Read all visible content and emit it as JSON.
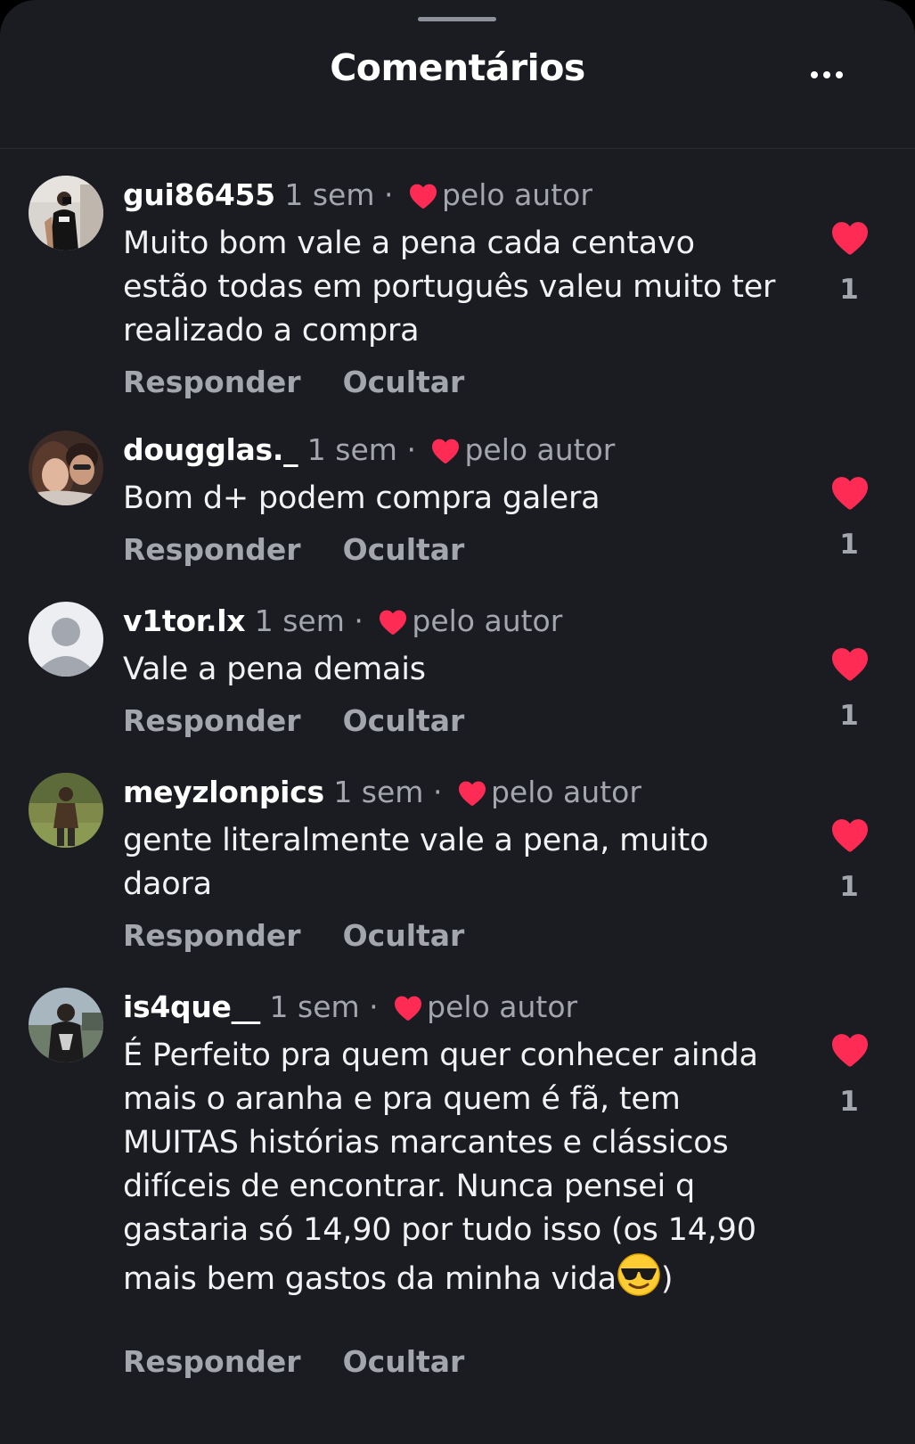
{
  "header": {
    "title": "Comentários",
    "more_icon": "more-horizontal-icon"
  },
  "colors": {
    "background": "#1b1c21",
    "text_primary": "#ffffff",
    "text_secondary": "#a3a6ad",
    "heart": "#fe2c55"
  },
  "comments": [
    {
      "username": "gui86455",
      "time": "1 sem",
      "separator": "·",
      "author_like_label": "pelo autor",
      "text": "Muito bom vale a pena cada centavo estão todas em português valeu muito ter realizado a compra",
      "reply_label": "Responder",
      "hide_label": "Ocultar",
      "likes": "1"
    },
    {
      "username": "dougglas._",
      "time": "1 sem",
      "separator": "·",
      "author_like_label": "pelo autor",
      "text": "Bom d+ podem compra galera",
      "reply_label": "Responder",
      "hide_label": "Ocultar",
      "likes": "1"
    },
    {
      "username": "v1tor.lx",
      "time": "1 sem",
      "separator": "·",
      "author_like_label": "pelo autor",
      "text": "Vale a pena demais",
      "reply_label": "Responder",
      "hide_label": "Ocultar",
      "likes": "1"
    },
    {
      "username": "meyzlonpics",
      "time": "1 sem",
      "separator": "·",
      "author_like_label": "pelo autor",
      "text": "gente literalmente vale a pena, muito daora",
      "reply_label": "Responder",
      "hide_label": "Ocultar",
      "likes": "1"
    },
    {
      "username": "is4que__",
      "time": "1 sem",
      "separator": "·",
      "author_like_label": "pelo autor",
      "text": "É Perfeito pra quem quer conhecer ainda mais o aranha e pra quem é fã, tem MUITAS histórias marcantes e clássicos difíceis de encontrar. Nunca pensei q gastaria só 14,90 por tudo isso (os 14,90 mais bem gastos da minha vida",
      "text_end": ")",
      "emoji_icon": "sunglasses-emoji-icon",
      "reply_label": "Responder",
      "hide_label": "Ocultar",
      "likes": "1"
    }
  ]
}
